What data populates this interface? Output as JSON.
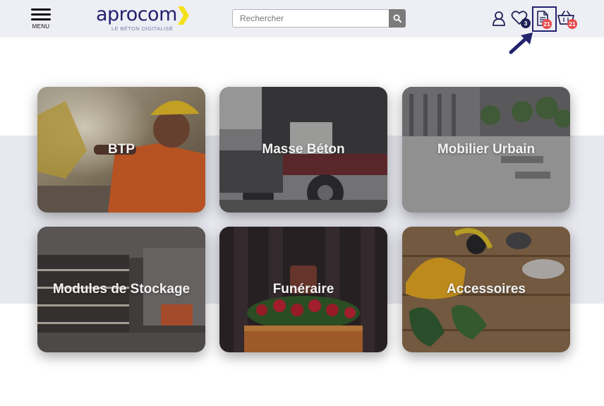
{
  "header": {
    "menu_label": "MENU",
    "logo_name": "aprocom",
    "logo_tagline": "LE BÉTON DIGITALISÉ",
    "search_placeholder": "Rechercher",
    "favorites_count": "3",
    "quotes_count": "21",
    "cart_count": "21"
  },
  "colors": {
    "brand_navy": "#22226e",
    "brand_yellow": "#f5e11a",
    "badge_red": "#e54b4b",
    "header_bg": "#eeeef5"
  },
  "icons": [
    "menu-icon",
    "search-icon",
    "user-icon",
    "heart-icon",
    "document-icon",
    "basket-icon",
    "pointer-arrow-icon"
  ],
  "categories": [
    {
      "label": "BTP"
    },
    {
      "label": "Masse Béton"
    },
    {
      "label": "Mobilier Urbain"
    },
    {
      "label": "Modules de Stockage"
    },
    {
      "label": "Funéraire"
    },
    {
      "label": "Accessoires"
    }
  ]
}
